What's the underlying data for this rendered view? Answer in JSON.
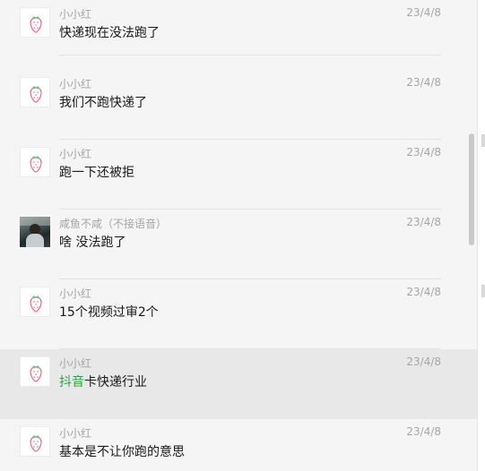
{
  "messages": [
    {
      "sender": "小小红",
      "time": "23/4/8",
      "text": "快递现在没法跑了",
      "avatar": "strawberry-icon"
    },
    {
      "sender": "小小红",
      "time": "23/4/8",
      "text": "我们不跑快递了",
      "avatar": "strawberry-icon"
    },
    {
      "sender": "小小红",
      "time": "23/4/8",
      "text": "跑一下还被拒",
      "avatar": "strawberry-icon"
    },
    {
      "sender": "咸鱼不咸（不接语音）",
      "time": "23/4/8",
      "text": "啥 没法跑了",
      "avatar": "photo-avatar"
    },
    {
      "sender": "小小红",
      "time": "23/4/8",
      "text": "15个视频过审2个",
      "avatar": "strawberry-icon"
    },
    {
      "sender": "小小红",
      "time": "23/4/8",
      "text_keyword": "抖音",
      "text_rest": "卡快递行业",
      "avatar": "strawberry-icon",
      "highlighted": true
    },
    {
      "sender": "小小红",
      "time": "23/4/8",
      "text": "基本是不让你跑的意思",
      "avatar": "strawberry-icon"
    }
  ],
  "colors": {
    "background": "#f5f5f5",
    "highlight_row": "#e8e8e8",
    "keyword": "#2ba245",
    "meta_text": "#a6a6a6",
    "message_text": "#191919"
  }
}
